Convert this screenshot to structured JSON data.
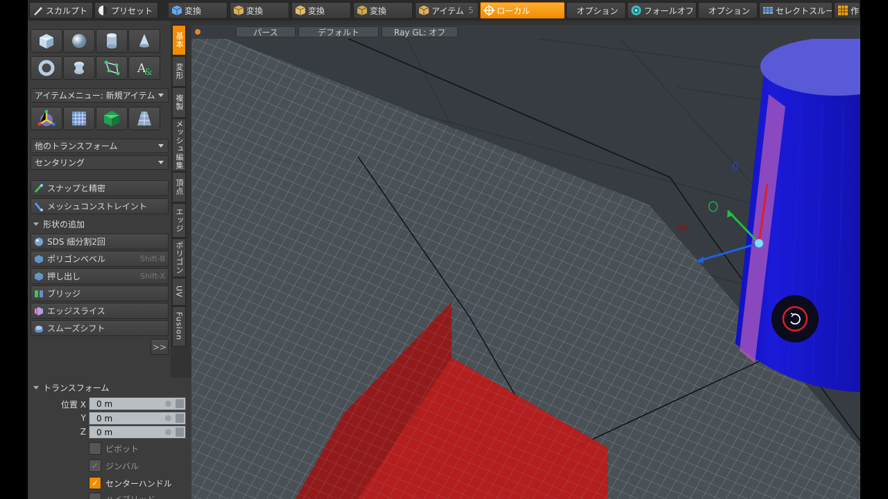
{
  "toolbar": {
    "items": [
      {
        "label": "スカルプト"
      },
      {
        "label": "プリセット"
      },
      {
        "label": "変換"
      },
      {
        "label": "変換"
      },
      {
        "label": "変換"
      },
      {
        "label": "変換"
      },
      {
        "label": "アイテム",
        "number": "5"
      },
      {
        "label": "ローカル"
      },
      {
        "label": "オプション"
      },
      {
        "label": "フォールオフ"
      },
      {
        "label": "オプション"
      },
      {
        "label": "セレクトスルー"
      },
      {
        "label": "作"
      }
    ]
  },
  "left_panel": {
    "item_menu": "アイテムメニュー: 新規アイテム",
    "other_transform": "他のトランスフォーム",
    "centering": "センタリング",
    "snap": "スナップと精密",
    "mesh_constraint": "メッシュコンストレイント",
    "add_shape_section": "形状の追加",
    "tools": [
      {
        "label": "SDS 細分割2回",
        "shortcut": ""
      },
      {
        "label": "ポリゴンベベル",
        "shortcut": "Shift-B"
      },
      {
        "label": "押し出し",
        "shortcut": "Shift-X"
      },
      {
        "label": "ブリッジ",
        "shortcut": ""
      },
      {
        "label": "エッジスライス",
        "shortcut": ""
      },
      {
        "label": "スムーズシフト",
        "shortcut": ""
      }
    ],
    "more_button": ">>"
  },
  "vertical_tabs": [
    "基本",
    "変形",
    "複製",
    "メッシュ編集",
    "頂点",
    "エッジ",
    "ポリゴン",
    "UV",
    "Fusion"
  ],
  "transform_panel": {
    "title": "トランスフォーム",
    "position_label": "位置 X",
    "y_label": "Y",
    "z_label": "Z",
    "x_value": "0 m",
    "y_value": "0 m",
    "z_value": "0 m",
    "pivot": "ピボット",
    "gimbal": "ジンバル",
    "center_handle": "センターハンドル",
    "hidden_option": "ハイブリッド",
    "gimbal_check": "✓",
    "center_check": "✓"
  },
  "viewport": {
    "view_mode": "パース",
    "shading": "デフォルト",
    "raygl": "Ray GL: オフ"
  },
  "colors": {
    "accent": "#f28c00",
    "cylinder": "#1a1ad9",
    "cube": "#c01818"
  }
}
